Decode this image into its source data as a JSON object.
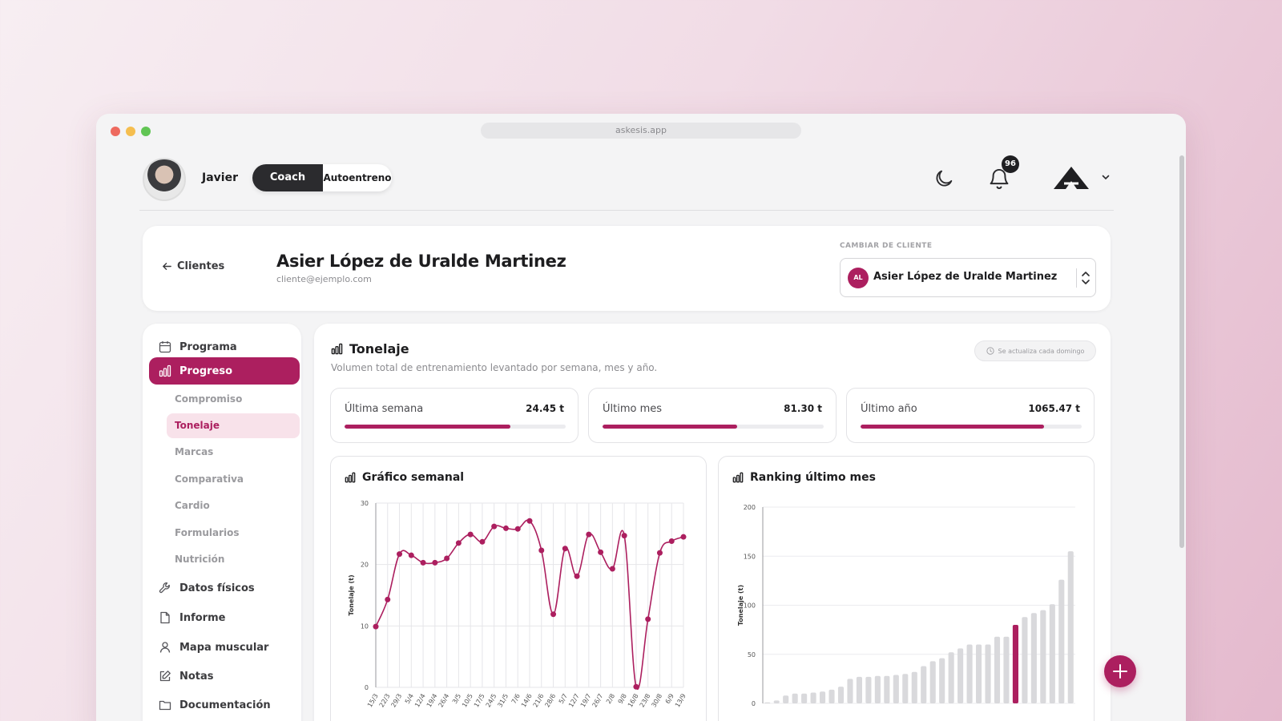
{
  "browser": {
    "url": "askesis.app"
  },
  "header": {
    "username": "Javier",
    "mode_coach": "Coach",
    "mode_auto": "Autoentreno",
    "notifications_count": "96"
  },
  "client": {
    "back_label": "Clientes",
    "name": "Asier López de Uralde Martinez",
    "email": "cliente@ejemplo.com",
    "change_label": "CAMBIAR DE CLIENTE",
    "select_initials": "AL",
    "select_value": "Asier López de Uralde Martinez"
  },
  "sidebar": {
    "items": [
      {
        "label": "Programa",
        "icon": "calendar-icon"
      },
      {
        "label": "Progreso",
        "icon": "bar-chart-icon"
      },
      {
        "label": "Datos físicos",
        "icon": "wrench-icon"
      },
      {
        "label": "Informe",
        "icon": "file-icon"
      },
      {
        "label": "Mapa muscular",
        "icon": "user-icon"
      },
      {
        "label": "Notas",
        "icon": "edit-icon"
      },
      {
        "label": "Documentación",
        "icon": "folder-icon"
      }
    ],
    "subitems": [
      "Compromiso",
      "Tonelaje",
      "Marcas",
      "Comparativa",
      "Cardio",
      "Formularios",
      "Nutrición"
    ],
    "active_subitem": "Tonelaje"
  },
  "main": {
    "title": "Tonelaje",
    "subtitle": "Volumen total de entrenamiento levantado por semana, mes y año.",
    "update_note": "Se actualiza cada domingo",
    "stats": [
      {
        "label": "Última semana",
        "value": "24.45 t",
        "progress": 0.75
      },
      {
        "label": "Último mes",
        "value": "81.30 t",
        "progress": 0.61
      },
      {
        "label": "Último año",
        "value": "1065.47 t",
        "progress": 0.83
      }
    ]
  },
  "colors": {
    "accent": "#ac1f5f",
    "accent_light": "#f8e2ea",
    "bar_grey": "#d9d9dc"
  },
  "chart_data": [
    {
      "type": "line",
      "title": "Gráfico semanal",
      "ylabel": "Tonelaje (t)",
      "ylim": [
        0,
        30
      ],
      "yticks": [
        0,
        10,
        20,
        30
      ],
      "grid": true,
      "x": [
        "15/3",
        "22/3",
        "29/3",
        "5/4",
        "12/4",
        "19/4",
        "26/4",
        "3/5",
        "10/5",
        "17/5",
        "24/5",
        "31/5",
        "7/6",
        "14/6",
        "21/6",
        "28/6",
        "5/7",
        "12/7",
        "19/7",
        "26/7",
        "2/8",
        "9/8",
        "16/8",
        "23/8",
        "30/8",
        "6/9",
        "13/9"
      ],
      "series": [
        {
          "values": [
            9.9,
            14.3,
            21.7,
            21.5,
            20.3,
            20.3,
            21.0,
            23.5,
            24.9,
            23.7,
            26.2,
            25.9,
            25.8,
            27.1,
            22.3,
            11.9,
            22.6,
            18.1,
            24.9,
            22.0,
            19.3,
            24.7,
            0.1,
            11.1,
            21.9,
            23.8,
            24.5
          ]
        }
      ]
    },
    {
      "type": "bar",
      "title": "Ranking último mes",
      "ylabel": "Tonelaje (t)",
      "ylim": [
        0,
        200
      ],
      "yticks": [
        0,
        50,
        100,
        150,
        200
      ],
      "grid": true,
      "values": [
        1,
        3,
        8,
        10,
        10,
        11,
        12,
        14,
        17,
        25,
        27,
        27,
        28,
        28,
        29,
        30,
        32,
        38,
        43,
        46,
        52,
        56,
        60,
        60,
        60,
        68,
        68,
        80,
        88,
        92,
        95,
        101,
        126,
        155
      ],
      "highlight_index": 27
    }
  ]
}
